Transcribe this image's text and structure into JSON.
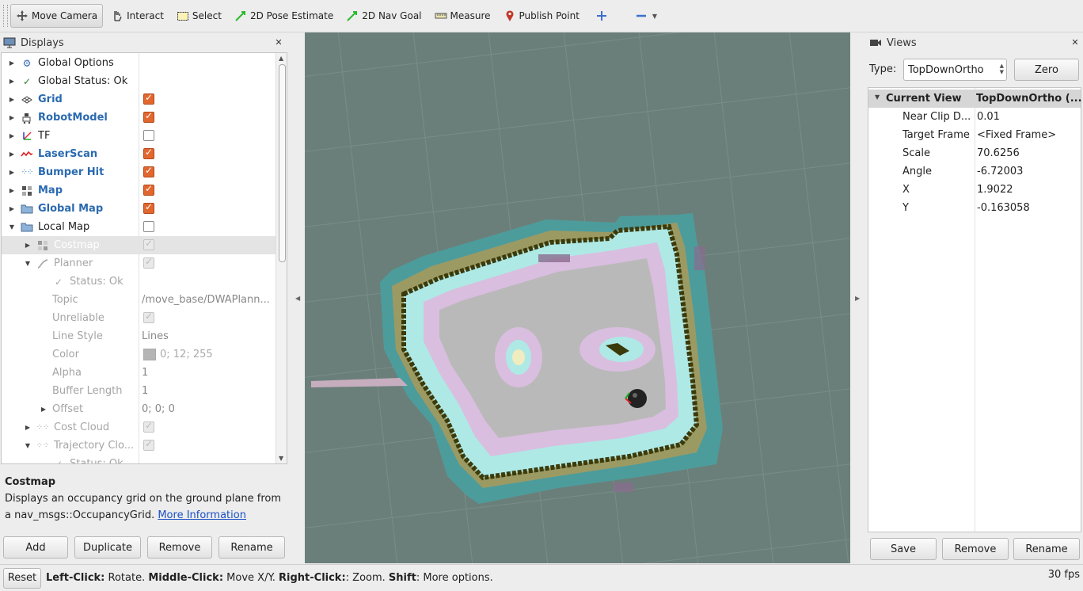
{
  "toolbar": {
    "tools": [
      {
        "label": "Move Camera",
        "icon": "move-camera-icon"
      },
      {
        "label": "Interact",
        "icon": "hand-icon"
      },
      {
        "label": "Select",
        "icon": "select-icon"
      },
      {
        "label": "2D Pose Estimate",
        "icon": "green-arrow-icon"
      },
      {
        "label": "2D Nav Goal",
        "icon": "green-arrow-icon"
      },
      {
        "label": "Measure",
        "icon": "ruler-icon"
      },
      {
        "label": "Publish Point",
        "icon": "pin-icon"
      }
    ]
  },
  "displays": {
    "title": "Displays",
    "items": [
      {
        "label": "Global Options",
        "icon": "gear-icon"
      },
      {
        "label": "Global Status: Ok",
        "icon": "check-icon"
      },
      {
        "label": "Grid",
        "icon": "grid-icon"
      },
      {
        "label": "RobotModel",
        "icon": "robot-icon"
      },
      {
        "label": "TF",
        "icon": "tf-icon"
      },
      {
        "label": "LaserScan",
        "icon": "laser-icon"
      },
      {
        "label": "Bumper Hit",
        "icon": "points-icon"
      },
      {
        "label": "Map",
        "icon": "map-icon"
      },
      {
        "label": "Global Map",
        "icon": "folder-icon"
      },
      {
        "label": "Local Map",
        "icon": "folder-icon"
      },
      {
        "label": "Costmap",
        "icon": "map-icon"
      },
      {
        "label": "Planner",
        "icon": "path-icon"
      },
      {
        "label": "Status: Ok",
        "icon": "check-icon"
      },
      {
        "label": "Topic",
        "value": "/move_base/DWAPlann..."
      },
      {
        "label": "Unreliable"
      },
      {
        "label": "Line Style",
        "value": "Lines"
      },
      {
        "label": "Color",
        "value": "0; 12; 255"
      },
      {
        "label": "Alpha",
        "value": "1"
      },
      {
        "label": "Buffer Length",
        "value": "1"
      },
      {
        "label": "Offset",
        "value": "0; 0; 0"
      },
      {
        "label": "Cost Cloud",
        "icon": "points-icon"
      },
      {
        "label": "Trajectory Clo...",
        "icon": "points-icon"
      },
      {
        "label": "Status: Ok",
        "icon": "check-icon"
      }
    ],
    "description": {
      "title": "Costmap",
      "text": "Displays an occupancy grid on the ground plane from a nav_msgs::OccupancyGrid.",
      "link": "More Information"
    },
    "buttons": {
      "add": "Add",
      "duplicate": "Duplicate",
      "remove": "Remove",
      "rename": "Rename"
    }
  },
  "views": {
    "title": "Views",
    "type_label": "Type:",
    "type_value": "TopDownOrtho",
    "zero": "Zero",
    "header": {
      "name": "Current View",
      "value": "TopDownOrtho (..."
    },
    "props": [
      {
        "key": "Near Clip D...",
        "value": "0.01"
      },
      {
        "key": "Target Frame",
        "value": "<Fixed Frame>"
      },
      {
        "key": "Scale",
        "value": "70.6256"
      },
      {
        "key": "Angle",
        "value": "-6.72003"
      },
      {
        "key": "X",
        "value": "1.9022"
      },
      {
        "key": "Y",
        "value": "-0.163058"
      }
    ],
    "buttons": {
      "save": "Save",
      "remove": "Remove",
      "rename": "Rename"
    }
  },
  "status": {
    "reset": "Reset",
    "lc": "Left-Click:",
    "lc_t": " Rotate. ",
    "mc": "Middle-Click:",
    "mc_t": " Move X/Y. ",
    "rc": "Right-Click:",
    "rc_t": ": Zoom. ",
    "sh": "Shift",
    "sh_t": ": More options.",
    "fps": "30 fps"
  },
  "colors": {
    "accent_checkbox": "#e2672f",
    "link": "#1a4fc4",
    "viewport_bg": "#6b7f7a"
  }
}
